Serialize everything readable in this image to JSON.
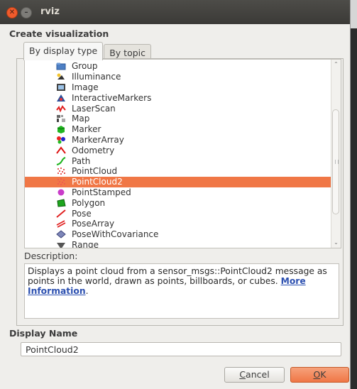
{
  "window": {
    "title": "rviz"
  },
  "header": {
    "title": "Create visualization"
  },
  "tabs": [
    {
      "label": "By display type",
      "active": true
    },
    {
      "label": "By topic",
      "active": false
    }
  ],
  "display_types": [
    {
      "label": "Group",
      "icon": "folder-icon"
    },
    {
      "label": "Illuminance",
      "icon": "illuminance-icon"
    },
    {
      "label": "Image",
      "icon": "image-icon"
    },
    {
      "label": "InteractiveMarkers",
      "icon": "interactive-markers-icon"
    },
    {
      "label": "LaserScan",
      "icon": "laserscan-icon"
    },
    {
      "label": "Map",
      "icon": "map-icon"
    },
    {
      "label": "Marker",
      "icon": "marker-cube-icon"
    },
    {
      "label": "MarkerArray",
      "icon": "marker-array-icon"
    },
    {
      "label": "Odometry",
      "icon": "odometry-icon"
    },
    {
      "label": "Path",
      "icon": "path-icon"
    },
    {
      "label": "PointCloud",
      "icon": "pointcloud-icon"
    },
    {
      "label": "PointCloud2",
      "icon": "pointcloud2-icon",
      "selected": true
    },
    {
      "label": "PointStamped",
      "icon": "point-stamped-icon"
    },
    {
      "label": "Polygon",
      "icon": "polygon-icon"
    },
    {
      "label": "Pose",
      "icon": "pose-icon"
    },
    {
      "label": "PoseArray",
      "icon": "pose-array-icon"
    },
    {
      "label": "PoseWithCovariance",
      "icon": "pose-with-covariance-icon"
    },
    {
      "label": "Range",
      "icon": "range-icon"
    }
  ],
  "description": {
    "label": "Description:",
    "text": "Displays a point cloud from a sensor_msgs::PointCloud2 message as points in the world, drawn as points, billboards, or cubes. ",
    "link_text": "More Information",
    "trailing": "."
  },
  "display_name": {
    "label": "Display Name",
    "value": "PointCloud2"
  },
  "buttons": {
    "cancel_rest": "ancel",
    "cancel_mnemonic": "C",
    "ok_rest": "K",
    "ok_mnemonic": "O"
  },
  "colors": {
    "selection": "#f07746",
    "titlebar": "#3c3b37",
    "link": "#2b4fb0"
  }
}
